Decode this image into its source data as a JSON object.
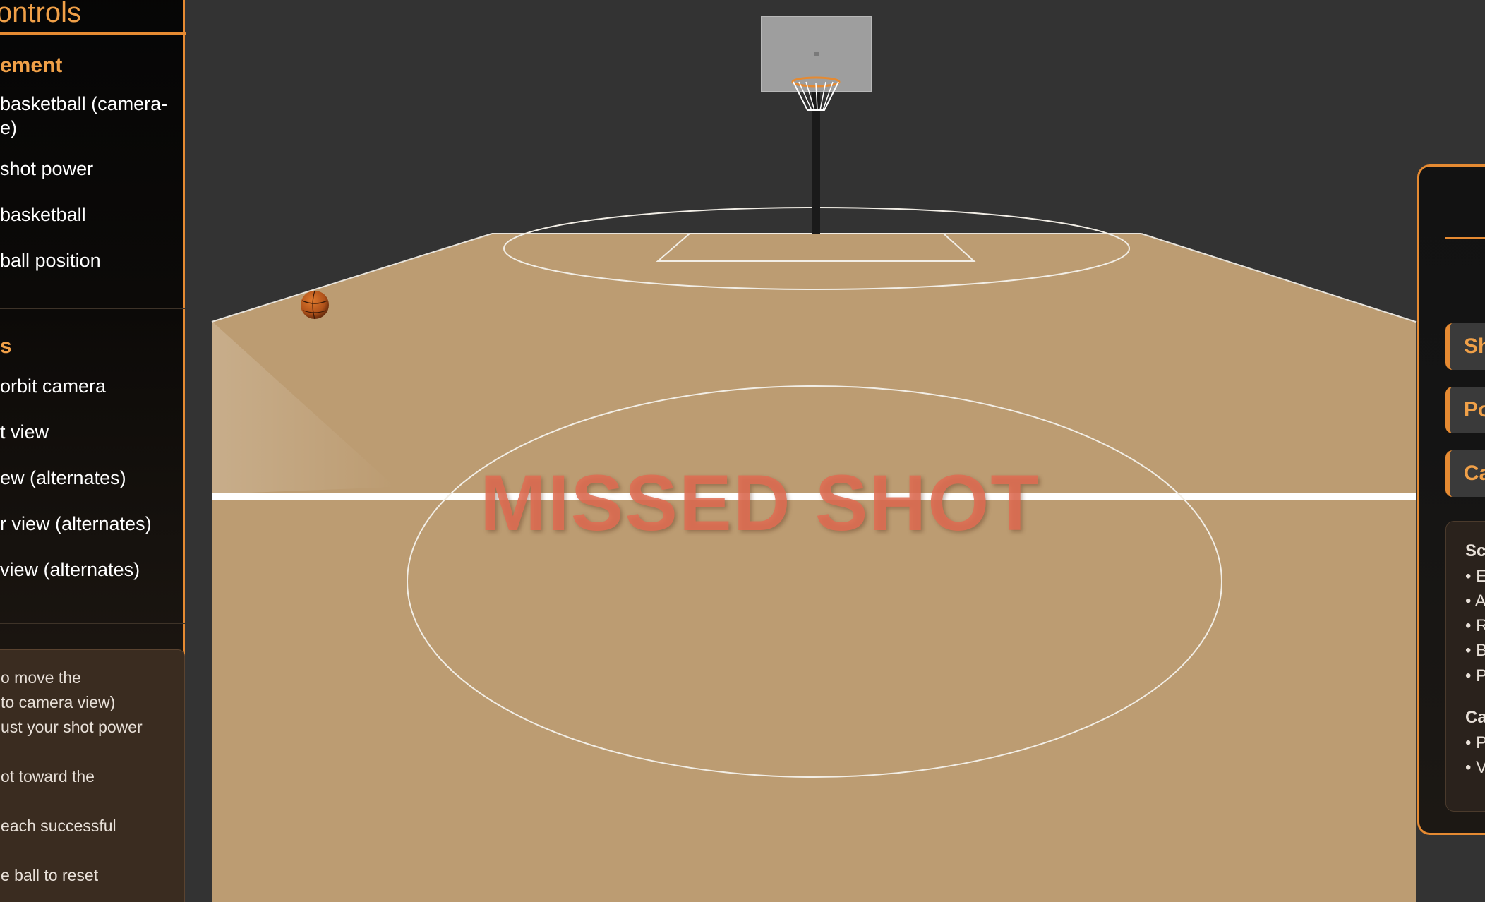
{
  "left_panel": {
    "title": "e Controls",
    "sections": [
      {
        "heading": "ement",
        "items": [
          "basketball (camera-",
          "e)",
          "shot power",
          "basketball",
          "ball position"
        ]
      },
      {
        "heading": "s",
        "items": [
          "orbit camera",
          "t view",
          "ew (alternates)",
          "r view (alternates)",
          "view (alternates)"
        ]
      }
    ],
    "instructions": [
      "o move the",
      "to camera view)",
      "ust your shot power",
      "ot toward the",
      "each successful",
      "e ball to reset"
    ]
  },
  "right_panel": {
    "buttons": [
      "Sh",
      "Po",
      "Ca"
    ],
    "info": {
      "score_heading": "Sc",
      "score_lines": [
        "• E",
        "• A",
        "• R",
        "• B",
        "• P"
      ],
      "camera_heading": "Ca",
      "camera_lines": [
        "• P",
        "• V"
      ]
    }
  },
  "game": {
    "status_message": "MISSED SHOT"
  },
  "colors": {
    "accent": "#e58a32",
    "accent_text": "#f0a048",
    "court": "#bc9c72",
    "background": "#333333",
    "missed_text": "#e06c52"
  },
  "icons": {
    "ball": "basketball-icon",
    "hoop": "basketball-hoop"
  }
}
